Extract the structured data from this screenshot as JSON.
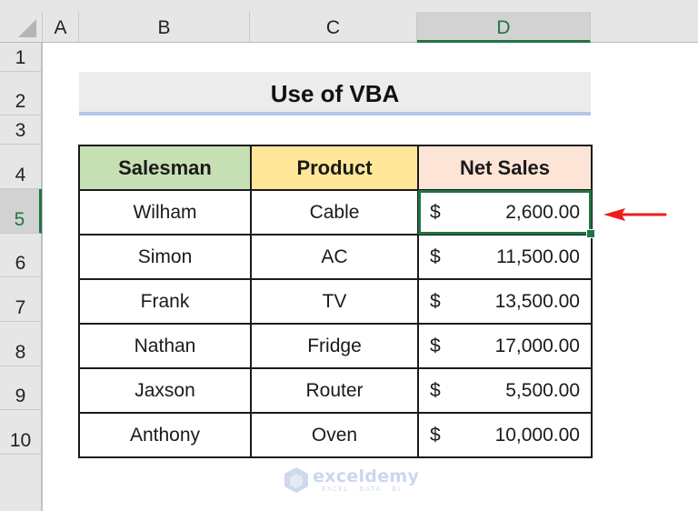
{
  "columns": [
    {
      "label": "A",
      "selected": false
    },
    {
      "label": "B",
      "selected": false
    },
    {
      "label": "C",
      "selected": false
    },
    {
      "label": "D",
      "selected": true
    }
  ],
  "rows": [
    "1",
    "2",
    "3",
    "4",
    "5",
    "6",
    "7",
    "8",
    "9",
    "10"
  ],
  "selected_row": "5",
  "title": "Use of VBA",
  "table": {
    "headers": {
      "salesman": "Salesman",
      "product": "Product",
      "net_sales": "Net Sales"
    },
    "records": [
      {
        "salesman": "Wilham",
        "product": "Cable",
        "currency": "$",
        "amount": "2,600.00"
      },
      {
        "salesman": "Simon",
        "product": "AC",
        "currency": "$",
        "amount": "11,500.00"
      },
      {
        "salesman": "Frank",
        "product": "TV",
        "currency": "$",
        "amount": "13,500.00"
      },
      {
        "salesman": "Nathan",
        "product": "Fridge",
        "currency": "$",
        "amount": "17,000.00"
      },
      {
        "salesman": "Jaxson",
        "product": "Router",
        "currency": "$",
        "amount": "5,500.00"
      },
      {
        "salesman": "Anthony",
        "product": "Oven",
        "currency": "$",
        "amount": "10,000.00"
      }
    ],
    "active_cell": "D5"
  },
  "annotation": {
    "icon": "red-arrow-left-icon",
    "color": "#ee1c1c"
  },
  "colors": {
    "accent_green": "#217346",
    "salesman_header": "#c6e0b4",
    "product_header": "#ffe699",
    "net_sales_header": "#fce4d6",
    "title_underline": "#b4c6e7"
  },
  "watermark": {
    "brand": "exceldemy",
    "tagline": "EXCEL · DATA · BI"
  }
}
